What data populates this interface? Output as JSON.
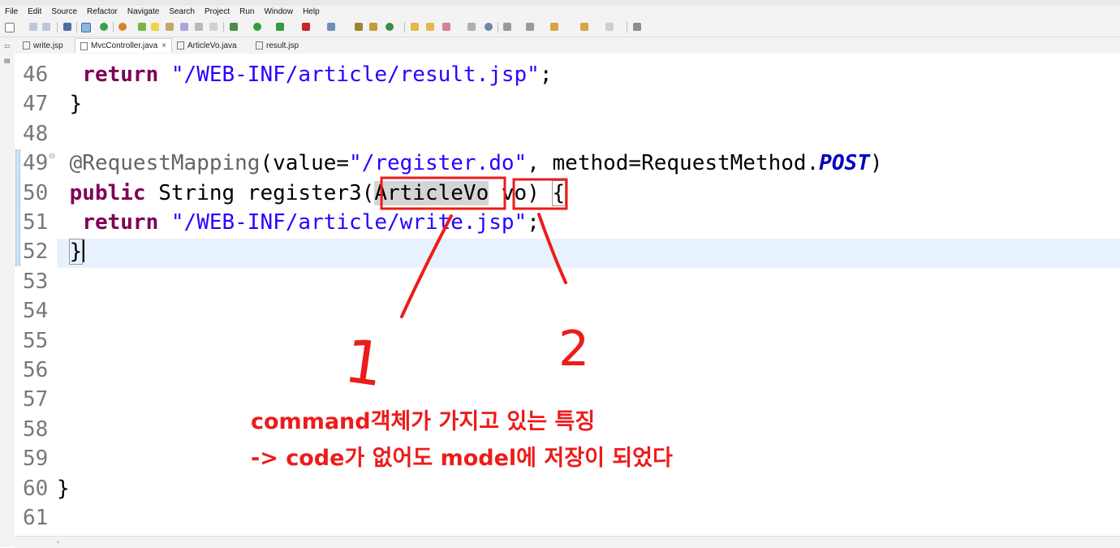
{
  "menu": [
    "File",
    "Edit",
    "Source",
    "Refactor",
    "Navigate",
    "Search",
    "Project",
    "Run",
    "Window",
    "Help"
  ],
  "tabs": [
    {
      "label": "write.jsp",
      "icon": "jsp-file-icon",
      "active": false
    },
    {
      "label": "MvcController.java",
      "icon": "java-file-icon",
      "active": true,
      "close": "×"
    },
    {
      "label": "ArticleVo.java",
      "icon": "java-file-icon",
      "active": false
    },
    {
      "label": "result.jsp",
      "icon": "jsp-file-icon",
      "active": false
    }
  ],
  "editor": {
    "lines": [
      {
        "n": "46",
        "indent": "  ",
        "tokens": [
          {
            "t": "return",
            "c": "kw"
          },
          {
            "t": " "
          },
          {
            "t": "\"/WEB-INF/article/result.jsp\"",
            "c": "str"
          },
          {
            "t": ";"
          }
        ]
      },
      {
        "n": "47",
        "indent": " ",
        "tokens": [
          {
            "t": "}"
          }
        ]
      },
      {
        "n": "48",
        "indent": "",
        "tokens": []
      },
      {
        "n": "49",
        "indent": " ",
        "fold": "⊖",
        "tokens": [
          {
            "t": "@RequestMapping",
            "c": "ann"
          },
          {
            "t": "(value="
          },
          {
            "t": "\"/register.do\"",
            "c": "str"
          },
          {
            "t": ", method=RequestMethod."
          },
          {
            "t": "POST",
            "c": "static-ital"
          },
          {
            "t": ")"
          }
        ]
      },
      {
        "n": "50",
        "indent": " ",
        "tokens": [
          {
            "t": "public",
            "c": "kw"
          },
          {
            "t": " String register3("
          },
          {
            "t": "ArticleVo",
            "c": "hl-occ"
          },
          {
            "t": " vo) "
          },
          {
            "t": "{",
            "c": "bracket-box"
          }
        ]
      },
      {
        "n": "51",
        "indent": "  ",
        "tokens": [
          {
            "t": "return",
            "c": "kw"
          },
          {
            "t": " "
          },
          {
            "t": "\"/WEB-INF/article/write.jsp\"",
            "c": "str"
          },
          {
            "t": ";"
          }
        ]
      },
      {
        "n": "52",
        "indent": " ",
        "caret": true,
        "tokens": [
          {
            "t": "}",
            "c": "bracket-box"
          }
        ]
      },
      {
        "n": "53",
        "indent": "",
        "tokens": []
      },
      {
        "n": "54",
        "indent": "",
        "tokens": []
      },
      {
        "n": "55",
        "indent": "",
        "tokens": []
      },
      {
        "n": "56",
        "indent": "",
        "tokens": []
      },
      {
        "n": "57",
        "indent": "",
        "tokens": []
      },
      {
        "n": "58",
        "indent": "",
        "tokens": []
      },
      {
        "n": "59",
        "indent": "",
        "tokens": []
      },
      {
        "n": "60",
        "indent": "",
        "tokens": [
          {
            "t": "}"
          }
        ]
      },
      {
        "n": "61",
        "indent": "",
        "tokens": []
      }
    ]
  },
  "annotation": {
    "color": "#ee1b1b",
    "number_1": "1",
    "number_2": "2",
    "note_line_1": "command객체가 가지고 있는 특징",
    "note_line_2": "-> code가 없어도 model에 저장이 되었다"
  }
}
